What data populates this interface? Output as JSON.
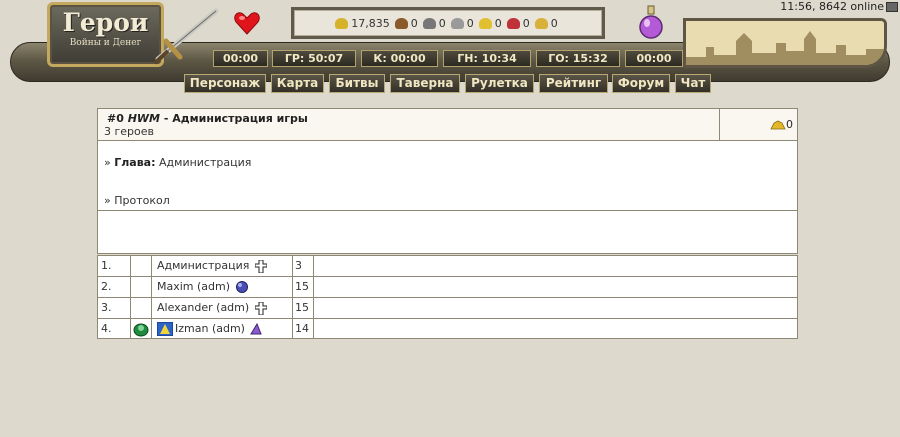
{
  "header": {
    "logo_title": "Герои",
    "logo_subtitle": "Войны и Денег",
    "clock_text": "11:56, 8642 online",
    "resources": [
      {
        "icon": "gold-icon",
        "value": "17,835",
        "color": "#d6b22a"
      },
      {
        "icon": "wood-icon",
        "value": "0",
        "color": "#8a5a2b"
      },
      {
        "icon": "ore-icon",
        "value": "0",
        "color": "#777777"
      },
      {
        "icon": "mercury-icon",
        "value": "0",
        "color": "#9a9a9a"
      },
      {
        "icon": "sulfur-icon",
        "value": "0",
        "color": "#e0c030"
      },
      {
        "icon": "crystal-icon",
        "value": "0",
        "color": "#c0323a"
      },
      {
        "icon": "gems-icon",
        "value": "0",
        "color": "#d7b13a"
      }
    ],
    "timers": [
      "00:00",
      "ГР: 50:07",
      "К: 00:00",
      "ГН: 10:34",
      "ГО: 15:32",
      "00:00"
    ],
    "nav": [
      "Персонаж",
      "Карта",
      "Битвы",
      "Таверна",
      "Рулетка",
      "Рейтинг",
      "Форум",
      "Чат"
    ]
  },
  "clan": {
    "id": "#0",
    "tag": "HWM",
    "name": "Администрация игры",
    "title_sep": " - ",
    "heroes_count": "3 героев",
    "gold": "0",
    "head_label": "Глава:",
    "head_value": "Администрация",
    "protocol_link": "Протокол",
    "bullet": "»"
  },
  "members": [
    {
      "num": "1.",
      "name": "Администрация",
      "level": "3",
      "icon": "cross-icon"
    },
    {
      "num": "2.",
      "name": "Maxim (adm)",
      "level": "15",
      "icon": "orb-icon"
    },
    {
      "num": "3.",
      "name": "Alexander (adm)",
      "level": "15",
      "icon": "cross-icon"
    },
    {
      "num": "4.",
      "name": "Izman (adm)",
      "level": "14",
      "icon": "wizard-hat-icon"
    }
  ]
}
